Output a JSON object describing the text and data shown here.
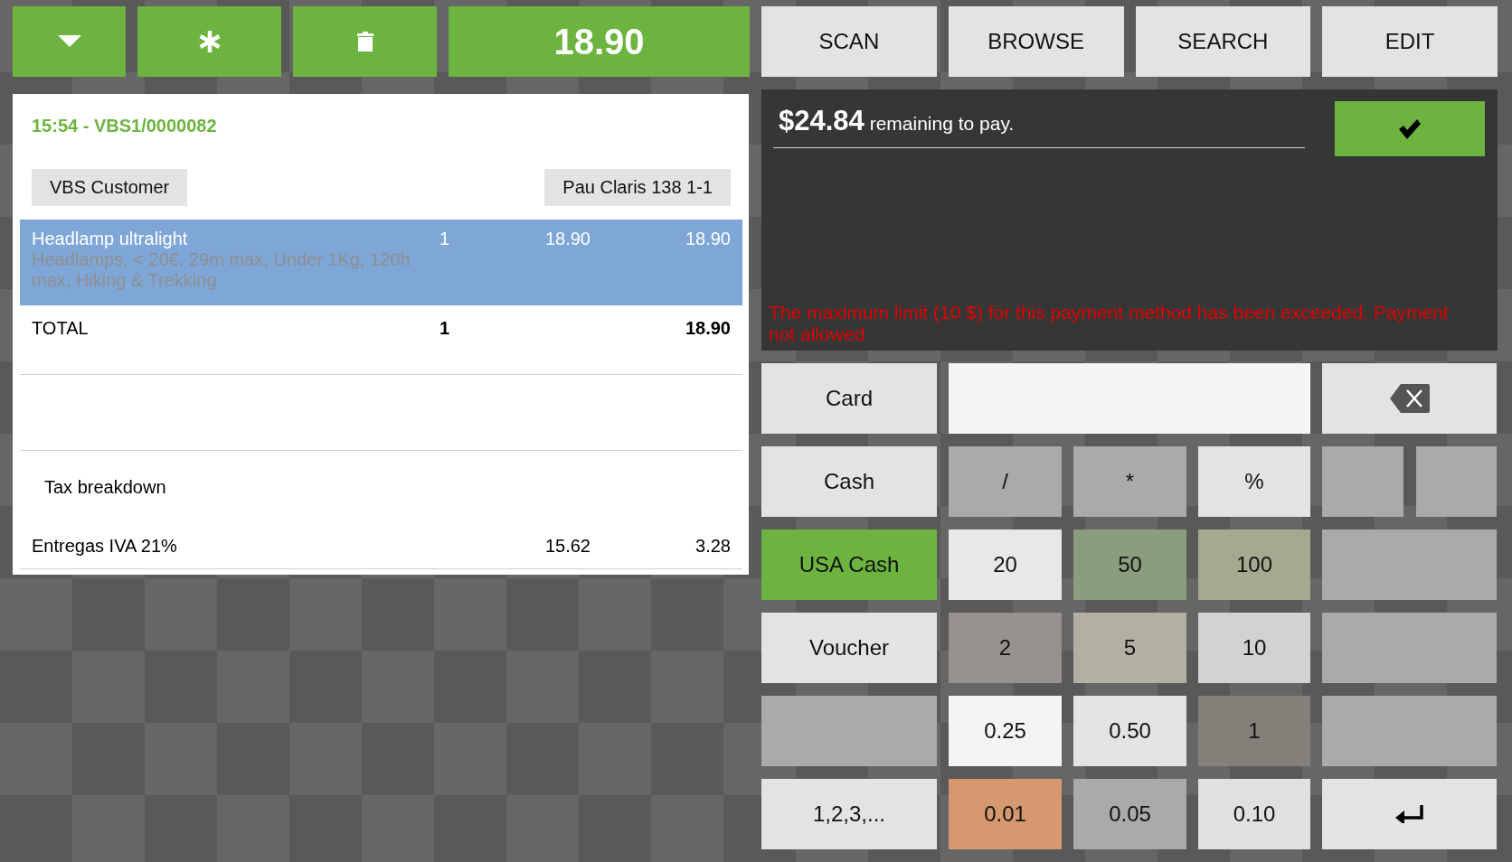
{
  "toolbar": {
    "buttons": [
      {
        "kind": "dropdown"
      },
      {
        "kind": "asterisk"
      },
      {
        "kind": "delete"
      }
    ],
    "total": "18.90"
  },
  "nav_buttons": [
    "SCAN",
    "BROWSE",
    "SEARCH",
    "EDIT"
  ],
  "receipt": {
    "header": "15:54 - VBS1/0000082",
    "customer": "VBS Customer",
    "address": "Pau Claris 138 1-1",
    "lines": [
      {
        "name": "Headlamp ultralight",
        "description": "Headlamps, < 20€, 29m max, Under 1Kg, 120h max, Hiking & Trekking",
        "quantity": "1",
        "price": "18.90",
        "amount": "18.90",
        "selected": true
      }
    ],
    "total": {
      "label": "TOTAL",
      "quantity": "1",
      "amount": "18.90"
    },
    "tax_title": "Tax breakdown",
    "taxes": [
      {
        "name": "Entregas IVA 21%",
        "base": "15.62",
        "amount": "3.28"
      }
    ]
  },
  "payment": {
    "amount": "$24.84",
    "message": "remaining to pay.",
    "error": "The maximum limit (10 $) for this payment method has been exceeded. Payment not allowed"
  },
  "payment_methods": [
    {
      "kind": "method",
      "label": "Card",
      "selected": false
    },
    {
      "kind": "method",
      "label": "Cash",
      "selected": false
    },
    {
      "kind": "method",
      "label": "USA Cash",
      "selected": true
    },
    {
      "kind": "method",
      "label": "Voucher",
      "selected": false
    },
    {
      "kind": "blank",
      "selected": false
    },
    {
      "kind": "method",
      "label": "1,2,3,...",
      "selected": false
    }
  ],
  "keys": [
    [
      {
        "label": "/",
        "color": "#aaaaaa"
      },
      {
        "label": "*",
        "color": "#aaaaaa"
      },
      {
        "label": "%",
        "color": "#e3e3e3"
      }
    ],
    [
      {
        "label": "20",
        "color": "#e8e8e8"
      },
      {
        "label": "50",
        "color": "#8a9e7e"
      },
      {
        "label": "100",
        "color": "#a6a890"
      }
    ],
    [
      {
        "label": "2",
        "color": "#96918c"
      },
      {
        "label": "5",
        "color": "#b3afa2"
      },
      {
        "label": "10",
        "color": "#d2d2d2"
      }
    ],
    [
      {
        "label": "0.25",
        "color": "#f4f4f4"
      },
      {
        "label": "0.50",
        "color": "#e3e3e3"
      },
      {
        "label": "1",
        "color": "#828078"
      }
    ],
    [
      {
        "label": "0.01",
        "color": "#d6986e"
      },
      {
        "label": "0.05",
        "color": "#aaaaaa"
      },
      {
        "label": "0.10",
        "color": "#e0e0e0"
      }
    ]
  ],
  "side_keys": [
    {
      "kind": "backspace"
    },
    {
      "kind": "split_blank"
    },
    {
      "kind": "blank"
    },
    {
      "kind": "blank"
    },
    {
      "kind": "blank"
    },
    {
      "kind": "enter"
    }
  ]
}
